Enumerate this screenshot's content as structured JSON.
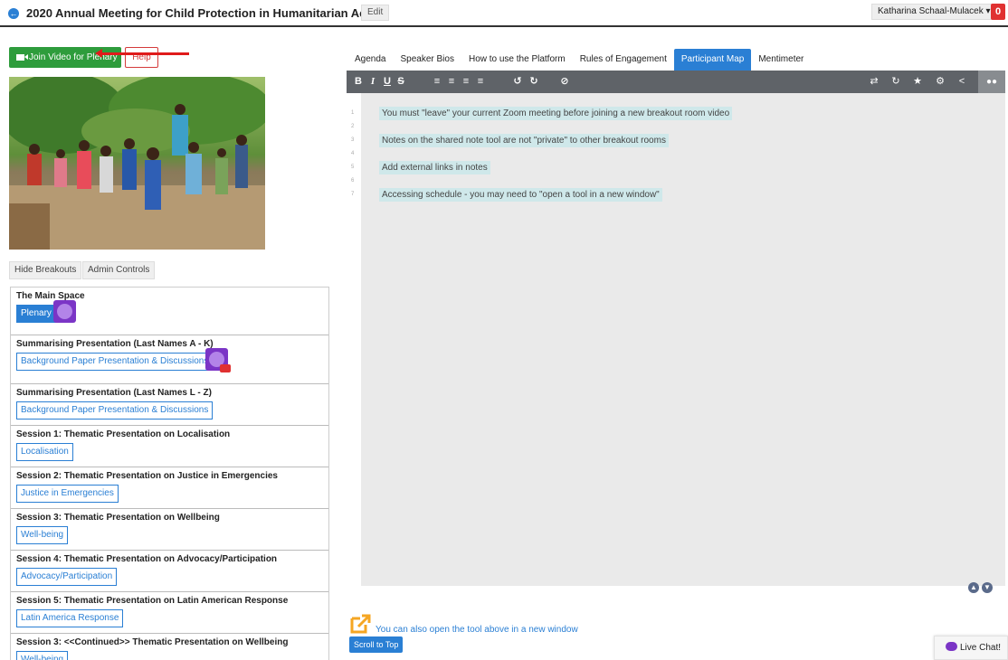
{
  "header": {
    "title": "2020 Annual Meeting for Child Protection in Humanitarian Acti...",
    "edit_label": "Edit",
    "user_name": "Katharina Schaal-Mulacek",
    "notification_count": "0"
  },
  "left": {
    "join_label": "Join Video for Plenary",
    "help_label": "Help",
    "hide_breakouts_label": "Hide Breakouts",
    "admin_controls_label": "Admin Controls",
    "rooms": [
      {
        "title": "The Main Space",
        "link": "Plenary"
      },
      {
        "title": "Summarising Presentation (Last Names A - K)",
        "link": "Background Paper Presentation & Discussions"
      },
      {
        "title": "Summarising Presentation (Last Names L - Z)",
        "link": "Background Paper Presentation & Discussions"
      },
      {
        "title": "Session 1: Thematic Presentation on Localisation",
        "link": "Localisation"
      },
      {
        "title": "Session 2: Thematic Presentation on Justice in Emergencies",
        "link": "Justice in Emergencies"
      },
      {
        "title": "Session 3: Thematic Presentation on Wellbeing",
        "link": "Well-being"
      },
      {
        "title": "Session 4: Thematic Presentation on Advocacy/Participation",
        "link": "Advocacy/Participation"
      },
      {
        "title": "Session 5: Thematic Presentation on Latin American Response",
        "link": "Latin America Response"
      },
      {
        "title": "Session 3: <<Continued>> Thematic Presentation on Wellbeing",
        "link": "Well-being"
      }
    ]
  },
  "tabs": [
    "Agenda",
    "Speaker Bios",
    "How to use the Platform",
    "Rules of Engagement",
    "Participant Map",
    "Mentimeter"
  ],
  "editor": {
    "line_numbers": [
      "1",
      "2",
      "3",
      "4",
      "5",
      "6",
      "7"
    ],
    "lines": [
      "You must \"leave\" your current Zoom meeting before joining a new breakout room video",
      "Notes on the shared note tool are not \"private\" to other breakout rooms",
      "Add external links in notes",
      "Accessing schedule - you may need to \"open a tool in a new window\""
    ]
  },
  "footer": {
    "open_new_text": "You can also open the tool above in a new window",
    "scroll_top_label": "Scroll to Top",
    "live_chat_label": "Live Chat!"
  },
  "colors": {
    "accent": "#2a7fd4",
    "join_green": "#2e9c3c",
    "badge_red": "#e03131",
    "avatar_purple": "#7b35c6",
    "toolbar_grey": "#5f6368"
  }
}
